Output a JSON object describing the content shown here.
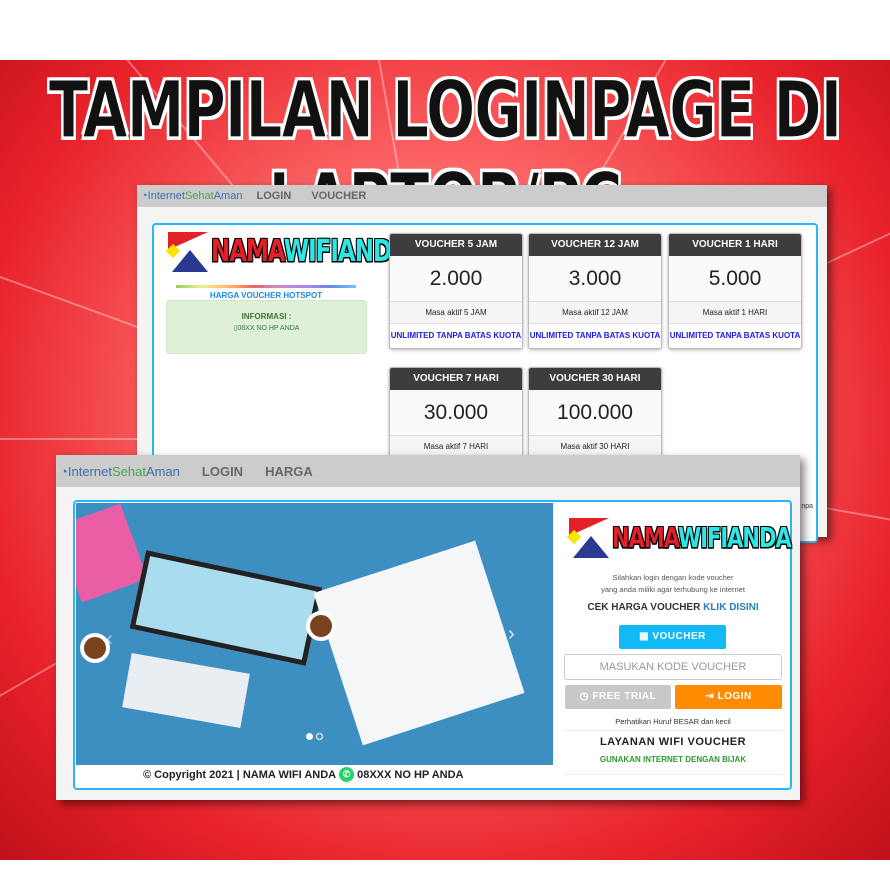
{
  "title": "TAMPILAN LOGINPAGE DI LAPTOP/PC",
  "back_window": {
    "brand_a": "Internet",
    "brand_b": "Sehat",
    "brand_c": "Aman",
    "nav": [
      "LOGIN",
      "VOUCHER"
    ],
    "logo_a": "NAMA",
    "logo_b": "WIFIANDA",
    "harga_label": "HARGA VOUCHER HOTSPOT",
    "info_title": "INFORMASI :",
    "info_phone": "08XX NO HP ANDA",
    "cards": [
      {
        "title": "VOUCHER 5 JAM",
        "price": "2.000",
        "masa": "Masa aktif 5 JAM",
        "note": "UNLIMITED TANPA BATAS KUOTA"
      },
      {
        "title": "VOUCHER 12 JAM",
        "price": "3.000",
        "masa": "Masa aktif 12 JAM",
        "note": "UNLIMITED TANPA BATAS KUOTA"
      },
      {
        "title": "VOUCHER 1 HARI",
        "price": "5.000",
        "masa": "Masa aktif 1 HARI",
        "note": "UNLIMITED TANPA BATAS KUOTA"
      },
      {
        "title": "VOUCHER 7 HARI",
        "price": "30.000",
        "masa": "Masa aktif 7 HARI"
      },
      {
        "title": "VOUCHER 30 HARI",
        "price": "100.000",
        "masa": "Masa aktif 30 HARI"
      }
    ],
    "cut_text": "npa"
  },
  "front_window": {
    "brand_a": "Internet",
    "brand_b": "Sehat",
    "brand_c": "Aman",
    "nav": [
      "LOGIN",
      "HARGA"
    ],
    "logo_a": "NAMA",
    "logo_b": "WIFIANDA",
    "intro_1": "Silahkan login dengan kode voucher",
    "intro_2": "yang anda miliki agar terhubung ke internet",
    "cek_harga": "CEK HARGA VOUCHER",
    "klik_disini": "KLIK DISINI",
    "voucher_button": "VOUCHER",
    "code_placeholder": "MASUKAN KODE VOUCHER",
    "free_trial": "FREE TRIAL",
    "login": "LOGIN",
    "case_note": "Perhatikan Huruf BESAR dan kecil",
    "service_title": "LAYANAN WIFI VOUCHER",
    "service_sub": "GUNAKAN INTERNET DENGAN BIJAK",
    "footer_copy": "© Copyright 2021 | NAMA WIFI ANDA",
    "footer_phone": "08XXX NO HP ANDA",
    "slides_total": 2,
    "slide_active": 1
  },
  "colors": {
    "accent": "#29b6f6",
    "login": "#ff8c00",
    "trial": "#c8c8c8",
    "info_bg": "#dff0d8",
    "card_header": "#3d3d3d"
  }
}
